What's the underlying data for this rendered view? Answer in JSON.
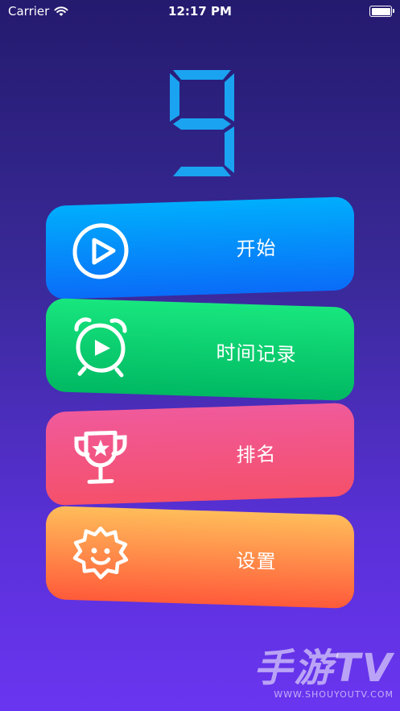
{
  "status_bar": {
    "carrier": "Carrier",
    "time": "12:17 PM"
  },
  "counter": {
    "value": "9",
    "color": "#1aa3f0"
  },
  "menu": {
    "start": {
      "label": "开始"
    },
    "time_record": {
      "label": "时间记录"
    },
    "ranking": {
      "label": "排名"
    },
    "settings": {
      "label": "设置"
    }
  },
  "watermark": {
    "brand": "手游TV",
    "url": "WWW.SHOUYOUTV.COM"
  }
}
